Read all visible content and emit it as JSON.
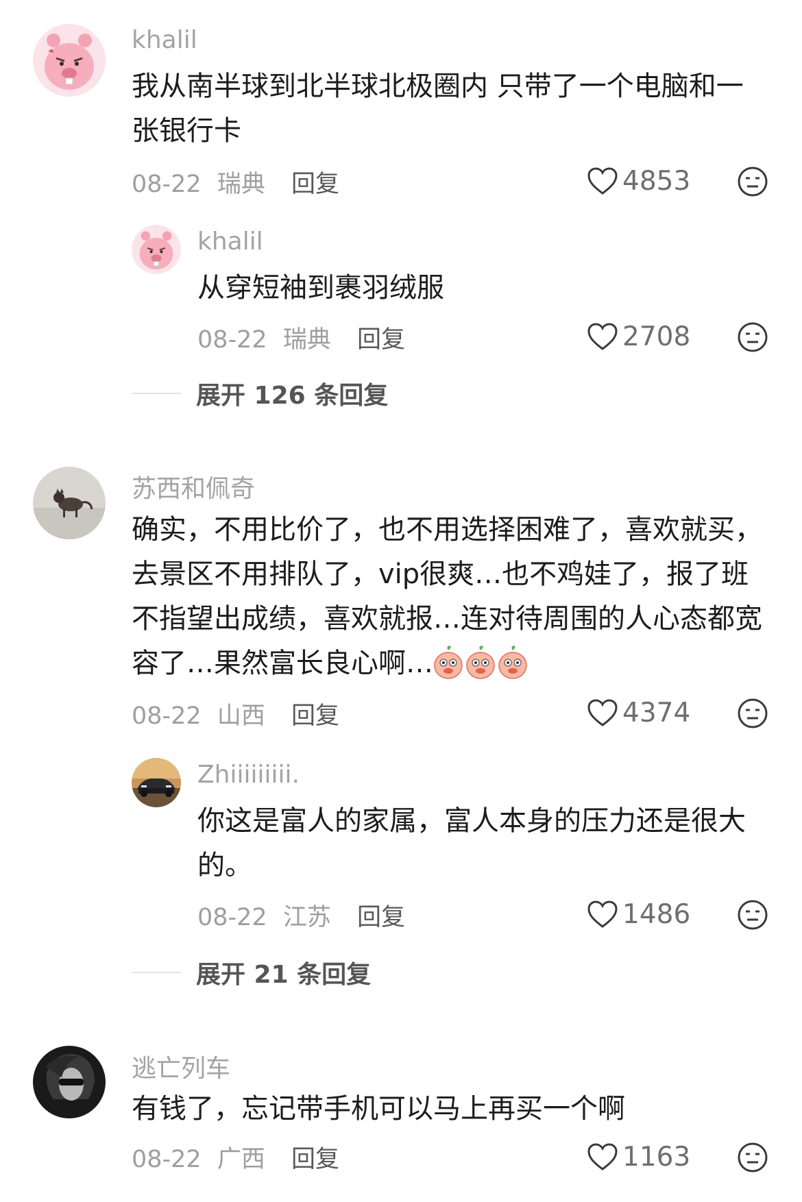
{
  "reply_label": "回复",
  "comments": [
    {
      "username": "khalil",
      "text": "我从南半球到北半球北极圈内 只带了一个电脑和一张银行卡",
      "date": "08-22",
      "location": "瑞典",
      "likes": "4853",
      "avatar": "pink-beaver-avatar",
      "replies": [
        {
          "username": "khalil",
          "text": "从穿短袖到裹羽绒服",
          "date": "08-22",
          "location": "瑞典",
          "likes": "2708",
          "avatar": "pink-beaver-avatar"
        }
      ],
      "expand_label": "展开 126 条回复"
    },
    {
      "username": "苏西和佩奇",
      "text": "确实，不用比价了，也不用选择困难了，喜欢就买，去景区不用排队了，vip很爽…也不鸡娃了，报了班不指望出成绩，喜欢就报…连对待周围的人心态都宽容了…果然富长良心啊…",
      "date": "08-22",
      "location": "山西",
      "likes": "4374",
      "avatar": "cat-photo-avatar",
      "replies": [
        {
          "username": "Zhiiiiiiiii.",
          "text": "你这是富人的家属，富人本身的压力还是很大的。",
          "date": "08-22",
          "location": "江苏",
          "likes": "1486",
          "avatar": "car-photo-avatar"
        }
      ],
      "expand_label": "展开 21 条回复"
    },
    {
      "username": "逃亡列车",
      "text": "有钱了，忘记带手机可以马上再买一个啊",
      "date": "08-22",
      "location": "广西",
      "likes": "1163",
      "avatar": "portrait-photo-avatar"
    }
  ]
}
